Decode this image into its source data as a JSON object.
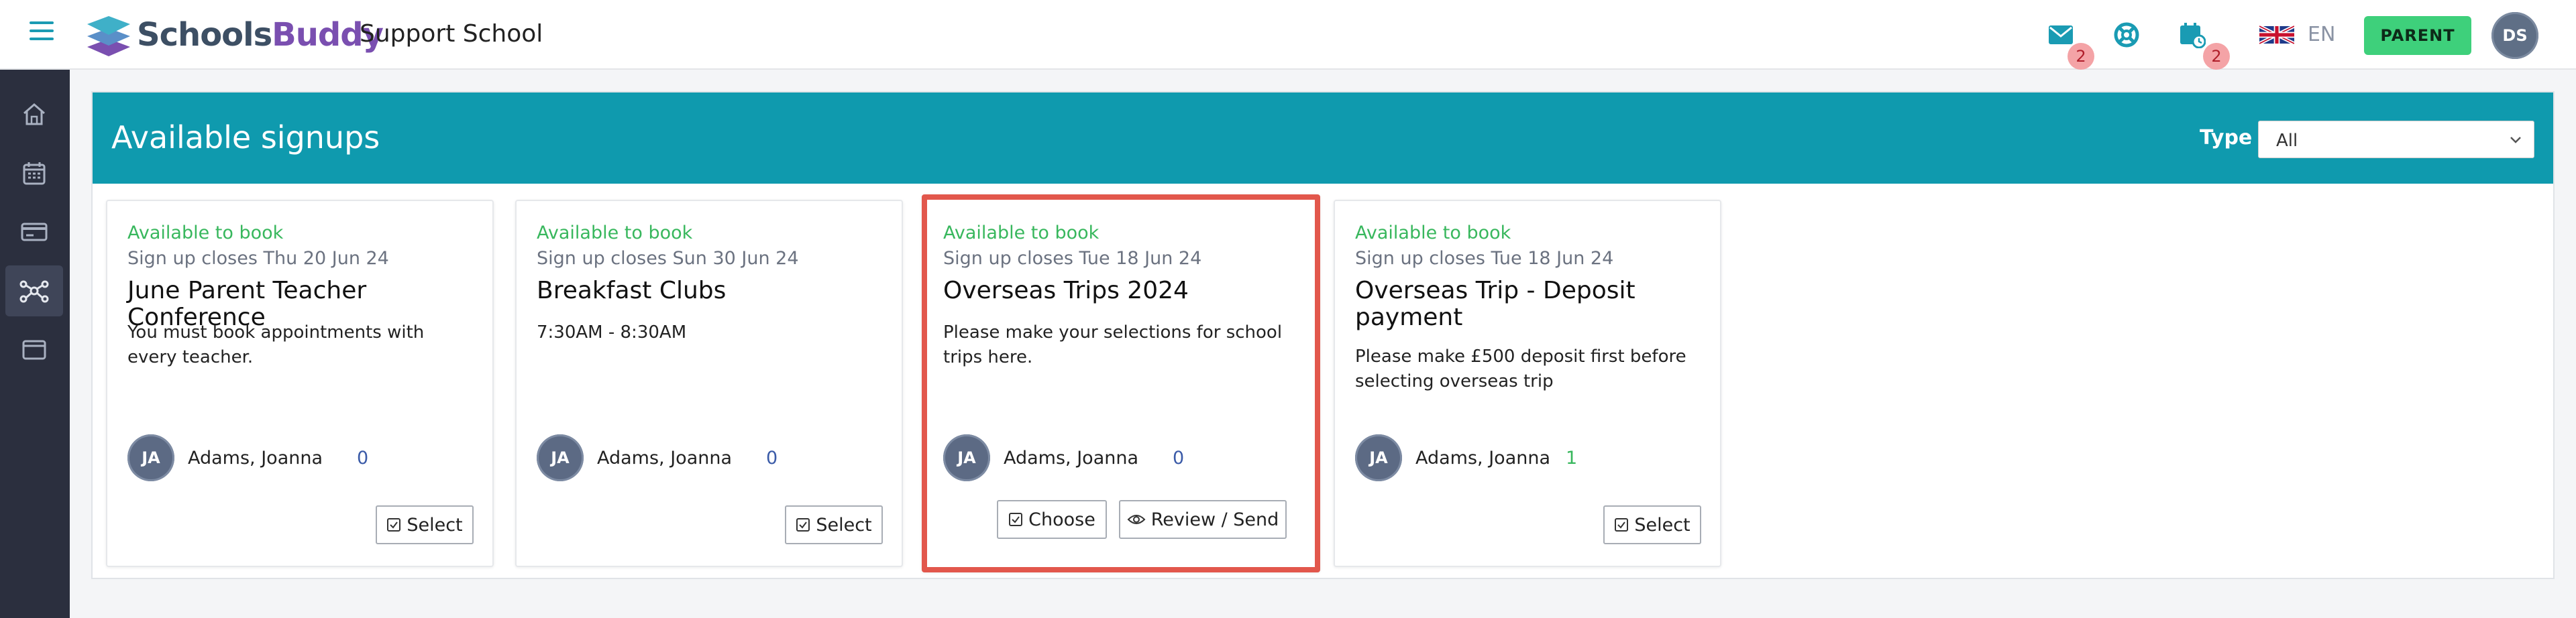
{
  "header": {
    "brand_part1": "Schools",
    "brand_part2": "Buddy",
    "school_name": "Support School",
    "messages_badge": "2",
    "calendar_badge": "2",
    "language": "EN",
    "role_button": "PARENT",
    "user_initials": "DS"
  },
  "sidebar": {
    "items": [
      {
        "icon": "home-icon"
      },
      {
        "icon": "calendar-icon"
      },
      {
        "icon": "payment-card-icon"
      },
      {
        "icon": "network-icon",
        "active": true
      },
      {
        "icon": "browser-window-icon"
      }
    ]
  },
  "panel": {
    "title": "Available signups",
    "type_label": "Type",
    "type_value": "All"
  },
  "cards": [
    {
      "status": "Available to book",
      "closes": "Sign up closes Thu 20 Jun 24",
      "title": "June Parent Teacher Conference",
      "description": "You must book appointments with every teacher.",
      "child_initials": "JA",
      "child_name": "Adams, Joanna",
      "count": "0",
      "button": "Select"
    },
    {
      "status": "Available to book",
      "closes": "Sign up closes Sun 30 Jun 24",
      "title": "Breakfast Clubs",
      "description": "7:30AM - 8:30AM",
      "child_initials": "JA",
      "child_name": "Adams, Joanna",
      "count": "0",
      "button": "Select"
    },
    {
      "status": "Available to book",
      "closes": "Sign up closes Tue 18 Jun 24",
      "title": "Overseas Trips 2024",
      "description": "Please make your selections for school trips here.",
      "child_initials": "JA",
      "child_name": "Adams, Joanna",
      "count": "0",
      "button": "Choose",
      "button2": "Review / Send"
    },
    {
      "status": "Available to book",
      "closes": "Sign up closes Tue 18 Jun 24",
      "title": "Overseas Trip - Deposit payment",
      "description": "Please make £500 deposit first before selecting overseas trip",
      "child_initials": "JA",
      "child_name": "Adams, Joanna",
      "count": "1",
      "button": "Select"
    }
  ],
  "colors": {
    "accent": "#0f9aae",
    "success": "#38b75d",
    "highlight": "#e2574c",
    "sidebar": "#2b2f3e"
  }
}
